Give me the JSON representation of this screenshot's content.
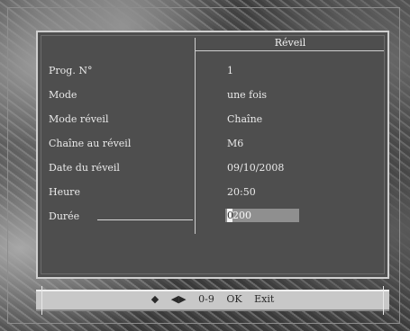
{
  "panel": {
    "title": "Réveil",
    "rows": [
      {
        "label": "Prog. N°",
        "value": "1"
      },
      {
        "label": "Mode",
        "value": "une fois"
      },
      {
        "label": "Mode réveil",
        "value": "Chaîne"
      },
      {
        "label": "Chaîne au réveil",
        "value": "M6"
      },
      {
        "label": "Date du réveil",
        "value": "09/10/2008"
      },
      {
        "label": "Heure",
        "value": "20:50"
      }
    ],
    "duration": {
      "label": "Durée",
      "cursor_char": "0",
      "rest": "200"
    }
  },
  "navbar": {
    "updown_icon": "◆",
    "leftright_icon": "◀▶",
    "digits": "0-9",
    "ok": "OK",
    "exit": "Exit"
  }
}
